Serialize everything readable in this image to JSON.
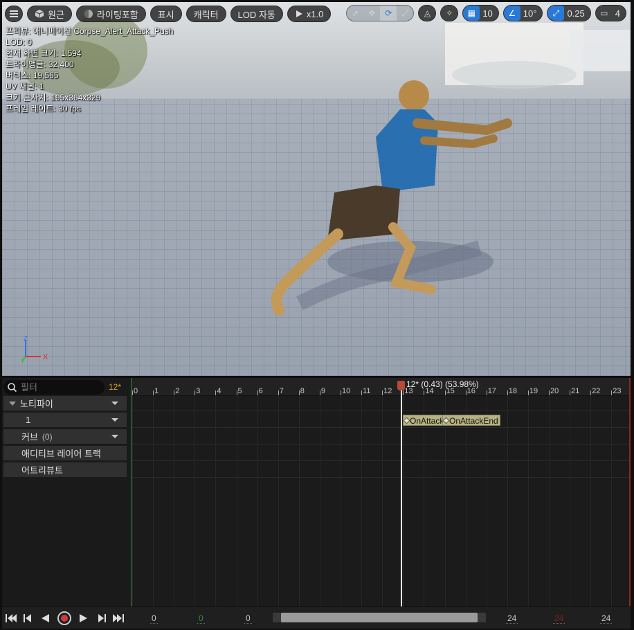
{
  "toolbar": {
    "perspective": "원근",
    "lighting": "라이팅포함",
    "show": "표시",
    "character": "캐릭터",
    "lod": "LOD 자동",
    "speed": "x1.0",
    "grid_snap": "10",
    "rotate_snap": "10°",
    "scale_snap": "0.25",
    "camera_speed": "4"
  },
  "stats": {
    "preview": "프리뷰: 애니메이션 Corpse_Alert_Attack_Push",
    "lod": "LOD: 0",
    "screen_size": "현재 화면 크기: 1.594",
    "triangles": "트라이앵글: 32,400",
    "vertices": "버텍스: 19,565",
    "uv_channels": "UV 채널: 1",
    "approx_size": "크기 근사치: 195x364x329",
    "frame_rate": "프레임 레이트: 30 fps"
  },
  "axis": {
    "z": "Z",
    "x": "X",
    "y": "Y"
  },
  "tracks": {
    "filter_placeholder": "필터",
    "current_frame_badge": "12*",
    "notifies": "노티파이",
    "notify_track": "1",
    "curves": "커브",
    "curves_count": "(0)",
    "additive": "애디티브 레이어 트랙",
    "attributes": "어트리뷰트"
  },
  "timeline": {
    "ticks": [
      "0",
      "1",
      "2",
      "3",
      "4",
      "5",
      "6",
      "7",
      "8",
      "9",
      "10",
      "11",
      "12",
      "13",
      "14",
      "15",
      "16",
      "17",
      "18",
      "19",
      "20",
      "21",
      "22",
      "23"
    ],
    "playhead_label": "12* (0.43) (53.98%)",
    "notifies": [
      {
        "label": "OnAttackStart"
      },
      {
        "label": "OnAttackEnd"
      }
    ]
  },
  "transport": {
    "view_start": "0",
    "work_start": "0",
    "play_start": "0",
    "play_end": "24",
    "work_end": "24",
    "view_end": "24"
  },
  "colors": {
    "accent": "#2a79d6",
    "playhead": "#b84a38",
    "notify": "#b7b282",
    "frame_badge": "#e0a030"
  }
}
